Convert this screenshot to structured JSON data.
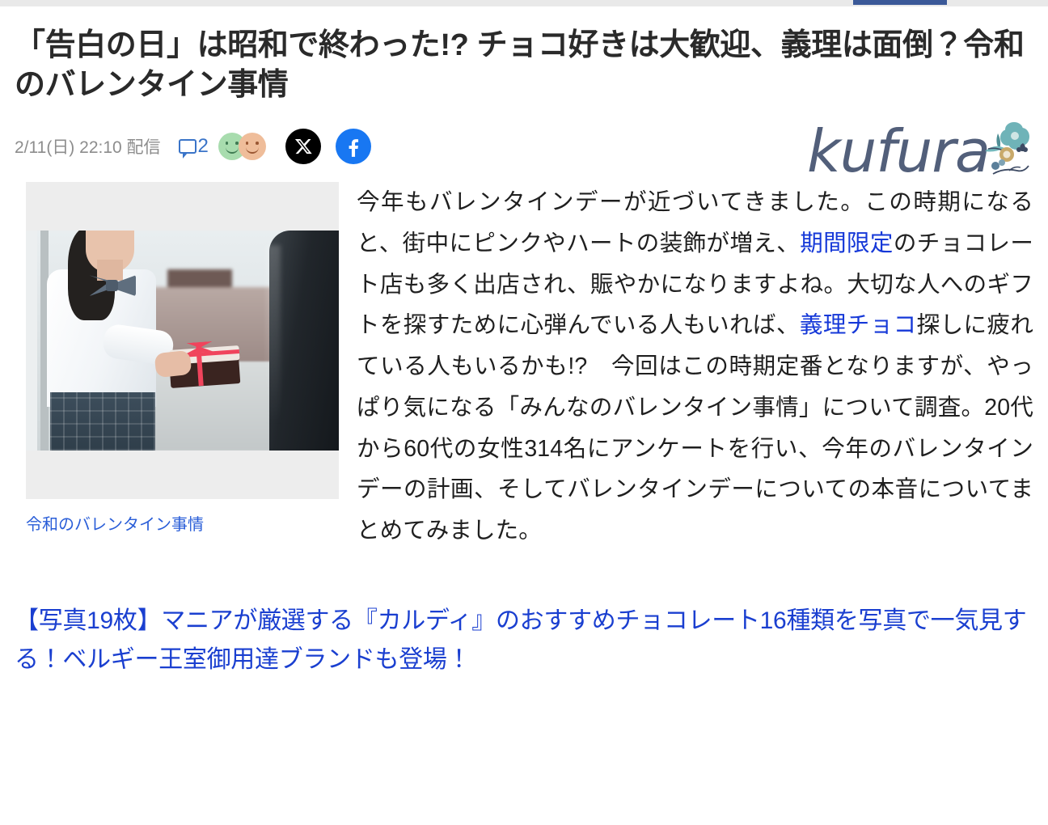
{
  "chrome": {
    "tab_indicator_color": "#3b5998",
    "strip_color": "#e9e9e9"
  },
  "article": {
    "headline": "「告白の日」は昭和で終わった!? チョコ好きは大歓迎、義理は面倒？令和のバレンタイン事情",
    "meta": {
      "date": "2/11(日) 22:10 配信",
      "comment_count": "2",
      "reactions": [
        {
          "name": "smiley-green",
          "color": "#a8dcae"
        },
        {
          "name": "smiley-peach",
          "color": "#efbd9a"
        }
      ],
      "share": [
        {
          "name": "x-twitter",
          "label": "X",
          "color": "#000000"
        },
        {
          "name": "facebook",
          "label": "f",
          "color": "#1877f2"
        }
      ]
    },
    "brand": {
      "name": "kufura",
      "color": "#525f7a",
      "flower_colors": [
        "#6fb3b8",
        "#c8a96a",
        "#3d4a63"
      ]
    },
    "figure": {
      "caption": "令和のバレンタイン事情",
      "alt": "制服の女性がリボンのかかった箱を手渡している写真"
    },
    "body": {
      "p1_a": "今年もバレンタインデーが近づいてきました。この時期になると、街中にピンクやハートの装飾が増え、",
      "link1": "期間限定",
      "p1_b": "のチョコレート店も多く出店され、賑やかになりますよね。大切な人へのギフトを探すために心弾んでいる人もいれば、",
      "link2": "義理チョコ",
      "p1_c": "探しに疲れている人もいるかも!?　今回はこの時期定番となりますが、やっぱり気になる「みんなのバレンタイン事情」について調査。20代から60代の女性314名にアンケートを行い、今年のバレンタインデーの計画、そしてバレンタインデーについての本音についてまとめてみました。"
    },
    "promo_link": "【写真19枚】マニアが厳選する『カルディ』のおすすめチョコレート16種類を写真で一気見する！ベルギー王室御用達ブランドも登場！",
    "colors": {
      "link": "#1538d8",
      "caption_link": "#2a5ed8",
      "promo_link": "#1a3fd0",
      "meta_text": "#8d8d8d",
      "headline": "#2a2a2a"
    }
  }
}
